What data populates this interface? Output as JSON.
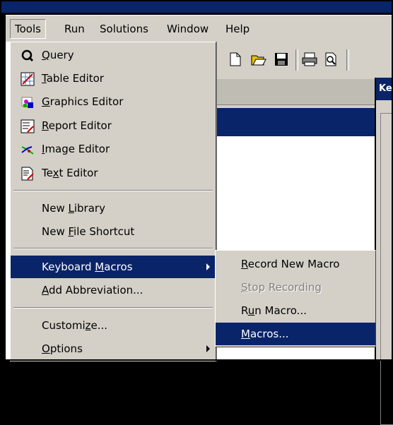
{
  "menubar": {
    "items": [
      {
        "label": "Tools",
        "selected": true
      },
      {
        "label": "Run"
      },
      {
        "label": "Solutions"
      },
      {
        "label": "Window"
      },
      {
        "label": "Help"
      }
    ]
  },
  "dialog": {
    "title": "Ke"
  },
  "tools_menu": {
    "items": [
      {
        "pre": "",
        "ul": "Q",
        "post": "uery",
        "icon": "query-icon"
      },
      {
        "pre": "",
        "ul": "T",
        "post": "able Editor",
        "icon": "table-editor-icon"
      },
      {
        "pre": "",
        "ul": "G",
        "post": "raphics Editor",
        "icon": "graphics-editor-icon"
      },
      {
        "pre": "",
        "ul": "R",
        "post": "eport Editor",
        "icon": "report-editor-icon"
      },
      {
        "pre": "",
        "ul": "I",
        "post": "mage Editor",
        "icon": "image-editor-icon"
      },
      {
        "pre": "Te",
        "ul": "x",
        "post": "t Editor",
        "icon": "text-editor-icon"
      },
      {
        "pre": "New ",
        "ul": "L",
        "post": "ibrary"
      },
      {
        "pre": "New ",
        "ul": "F",
        "post": "ile Shortcut"
      },
      {
        "pre": "Keyboard ",
        "ul": "M",
        "post": "acros",
        "highlighted": true,
        "submenu": true
      },
      {
        "pre": "",
        "ul": "A",
        "post": "dd Abbreviation..."
      },
      {
        "pre": "Customi",
        "ul": "z",
        "post": "e..."
      },
      {
        "pre": "",
        "ul": "O",
        "post": "ptions",
        "submenu": true
      }
    ]
  },
  "macros_submenu": {
    "items": [
      {
        "pre": "",
        "ul": "R",
        "post": "ecord New Macro"
      },
      {
        "pre": "",
        "ul": "S",
        "post": "top Recording",
        "disabled": true
      },
      {
        "pre": "R",
        "ul": "u",
        "post": "n Macro..."
      },
      {
        "pre": "",
        "ul": "M",
        "post": "acros...",
        "highlighted": true
      }
    ]
  },
  "colors": {
    "menu_bg": "#d4d0c8",
    "highlight": "#0a246a",
    "disabled_text": "#808080"
  }
}
